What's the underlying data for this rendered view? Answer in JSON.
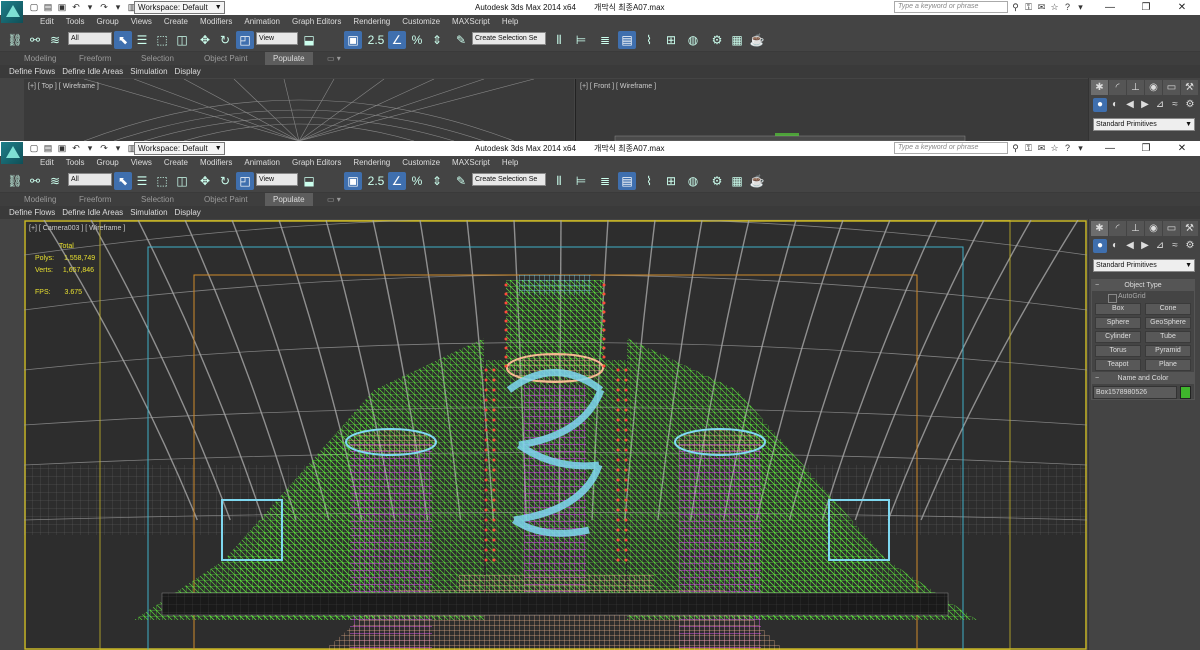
{
  "app": {
    "title": "Autodesk 3ds Max  2014 x64",
    "filename": "개막식 최종A07.max",
    "workspace": "Workspace: Default",
    "search_placeholder": "Type a keyword or phrase"
  },
  "menu": [
    "Edit",
    "Tools",
    "Group",
    "Views",
    "Create",
    "Modifiers",
    "Animation",
    "Graph Editors",
    "Rendering",
    "Customize",
    "MAXScript",
    "Help"
  ],
  "toolbar": {
    "filter": "All",
    "refcoord": "View",
    "selection_set_placeholder": "Create Selection Se",
    "snap_label": "2.5"
  },
  "ribbon_tabs": [
    "Modeling",
    "Freeform",
    "Selection",
    "Object Paint",
    "Populate"
  ],
  "populate_sub": [
    "Define Flows",
    "Define Idle Areas",
    "Simulation",
    "Display"
  ],
  "window1": {
    "vp_top_label": "[+] [ Top ] [ Wireframe ]",
    "vp_front_label": "[+] [ Front ] [ Wireframe ]"
  },
  "window2": {
    "vp_camera_label": "[+] [ Camera003 ] [ Wireframe ]",
    "stats": {
      "total_label": "Total",
      "polys_label": "Polys:",
      "polys_value": "1,558,749",
      "verts_label": "Verts:",
      "verts_value": "1,657,846",
      "fps_label": "FPS:",
      "fps_value": "3.675"
    }
  },
  "command_panel": {
    "category": "Standard Primitives",
    "object_type_title": "Object Type",
    "autogrid": "AutoGrid",
    "buttons": [
      "Box",
      "Cone",
      "Sphere",
      "GeoSphere",
      "Cylinder",
      "Tube",
      "Torus",
      "Pyramid",
      "Teapot",
      "Plane"
    ],
    "name_color_title": "Name and Color",
    "object_name": "Box1578980526",
    "object_color": "#3fb52c"
  },
  "colors": {
    "wire_green": "#5ce63a",
    "wire_magenta": "#cc44e0",
    "wire_cyan": "#7fd8f0",
    "wire_peach": "#f4b890",
    "active_blue": "#3f6fae",
    "frame_yellow": "#c8b628"
  }
}
